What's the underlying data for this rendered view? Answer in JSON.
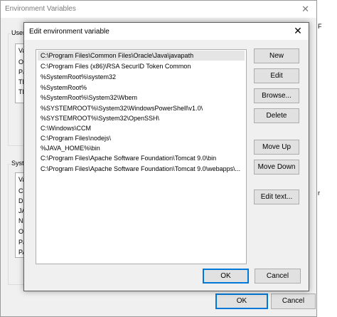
{
  "background_window": {
    "title": "Environment Variables",
    "user_group_label": "User",
    "user_list_items": [
      "Va",
      "On",
      "Pa",
      "TE",
      "TM"
    ],
    "system_group_label": "Syste",
    "system_list_items": [
      "Va",
      "Co",
      "Dr",
      "JA",
      "NU",
      "OS",
      "Pa",
      "PA"
    ],
    "ok_label": "OK",
    "cancel_label": "Cancel",
    "edge_text_top": "F",
    "edge_text_mid": "r"
  },
  "dialog": {
    "title": "Edit environment variable",
    "paths": [
      "C:\\Program Files\\Common Files\\Oracle\\Java\\javapath",
      "C:\\Program Files (x86)\\RSA SecurID Token Common",
      "%SystemRoot%\\system32",
      "%SystemRoot%",
      "%SystemRoot%\\System32\\Wbem",
      "%SYSTEMROOT%\\System32\\WindowsPowerShell\\v1.0\\",
      "%SYSTEMROOT%\\System32\\OpenSSH\\",
      "C:\\Windows\\CCM",
      "C:\\Program Files\\nodejs\\",
      "%JAVA_HOME%\\bin",
      "C:\\Program Files\\Apache Software Foundation\\Tomcat 9.0\\bin",
      "C:\\Program Files\\Apache Software Foundation\\Tomcat 9.0\\webapps\\..."
    ],
    "buttons": {
      "new": "New",
      "edit": "Edit",
      "browse": "Browse...",
      "delete": "Delete",
      "move_up": "Move Up",
      "move_down": "Move Down",
      "edit_text": "Edit text...",
      "ok": "OK",
      "cancel": "Cancel"
    },
    "close_glyph": "✕"
  }
}
